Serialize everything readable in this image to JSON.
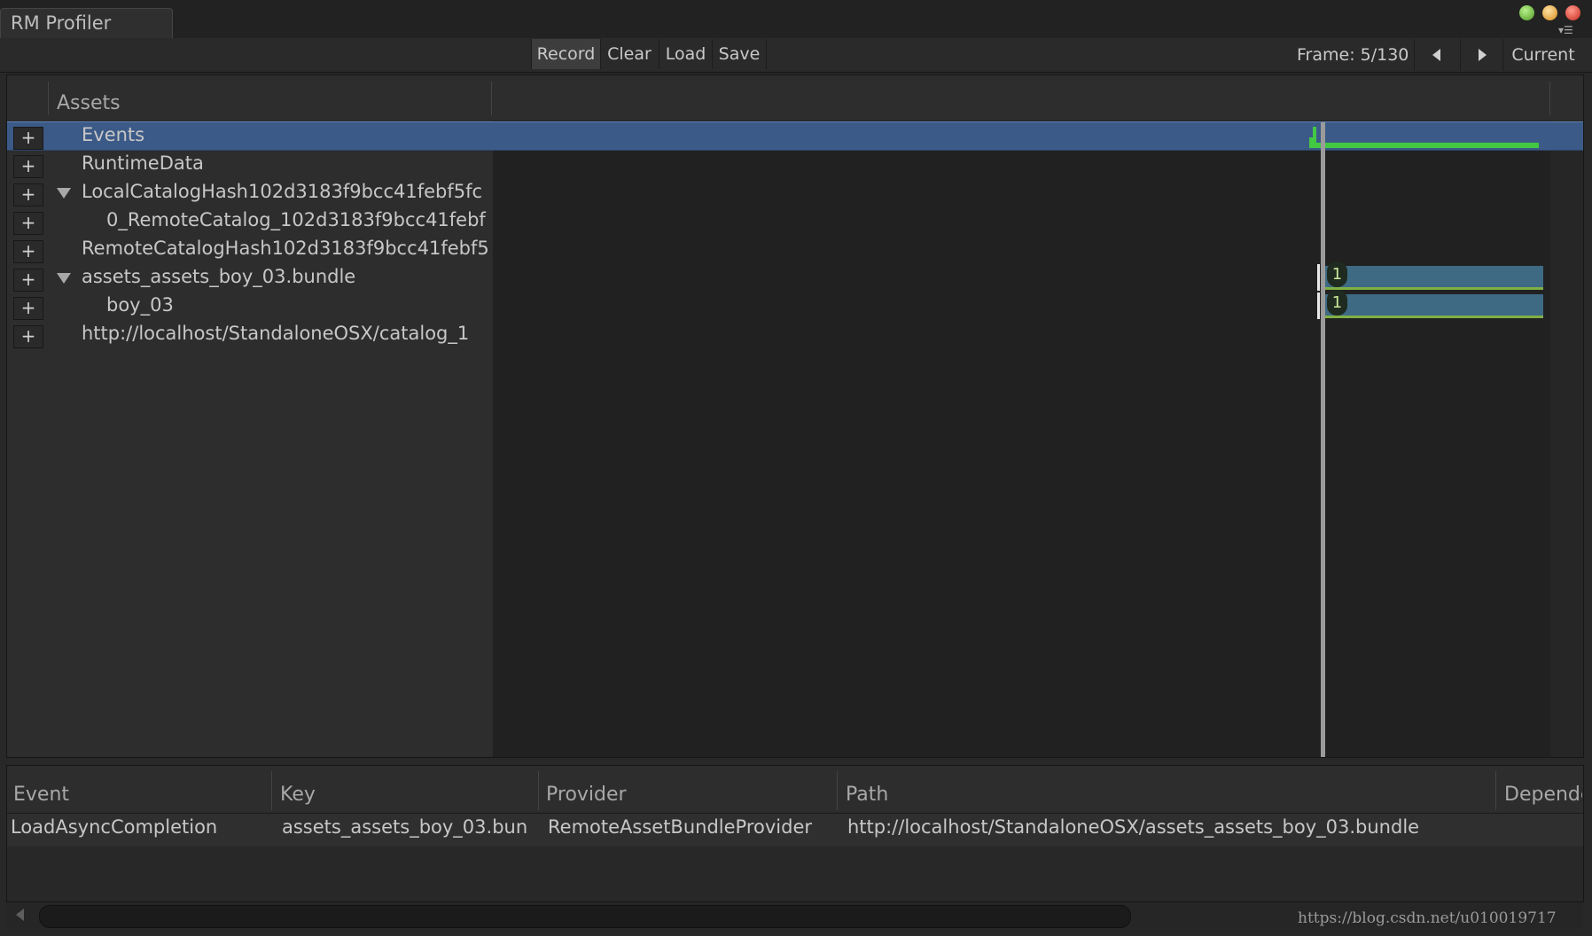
{
  "window": {
    "title": "RM Profiler"
  },
  "toolbar": {
    "record": "Record",
    "clear": "Clear",
    "load": "Load",
    "save": "Save",
    "frame": "Frame: 5/130",
    "current": "Current"
  },
  "tree": {
    "header": "Assets",
    "rows": [
      {
        "label": "Events"
      },
      {
        "label": "RuntimeData"
      },
      {
        "label": "LocalCatalogHash102d3183f9bcc41febf5fc"
      },
      {
        "label": "0_RemoteCatalog_102d3183f9bcc41febf"
      },
      {
        "label": "RemoteCatalogHash102d3183f9bcc41febf5"
      },
      {
        "label": "assets_assets_boy_03.bundle"
      },
      {
        "label": "boy_03"
      },
      {
        "label": "http://localhost/StandaloneOSX/catalog_1"
      }
    ]
  },
  "timeline": {
    "badges": [
      "1",
      "1"
    ],
    "colors": {
      "event": "#43c843",
      "bar": "#3e6a84",
      "selection": "#3c5a87"
    }
  },
  "events_table": {
    "columns": [
      "Event",
      "Key",
      "Provider",
      "Path",
      "Depende"
    ],
    "rows": [
      {
        "event": "LoadAsyncCompletion",
        "key": "assets_assets_boy_03.bun",
        "provider": "RemoteAssetBundleProvider",
        "path": "http://localhost/StandaloneOSX/assets_assets_boy_03.bundle"
      }
    ]
  },
  "watermark": "https://blog.csdn.net/u010019717"
}
